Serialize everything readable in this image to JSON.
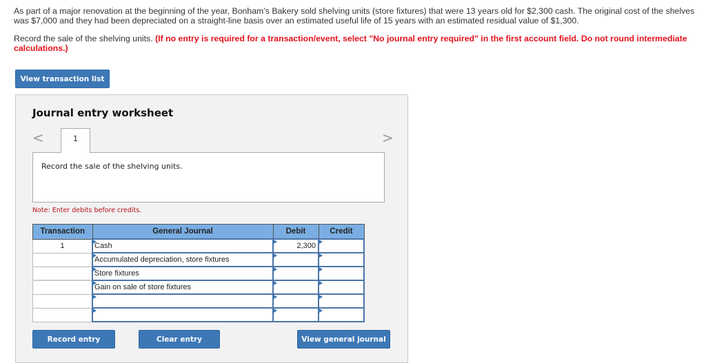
{
  "problem": {
    "paragraph1": "As part of a major renovation at the beginning of the year, Bonham’s Bakery sold shelving units (store fixtures) that were 13 years old for $2,300 cash. The original cost of the shelves was $7,000 and they had been depreciated on a straight-line basis over an estimated useful life of 15 years with an estimated residual value of $1,300.",
    "instruction": "Record the sale of the shelving units.",
    "instruction_note": "(If no entry is required for a transaction/event, select \"No journal entry required\" in the first account field. Do not round intermediate calculations.)"
  },
  "buttons": {
    "view_transaction_list": "View transaction list",
    "record_entry": "Record entry",
    "clear_entry": "Clear entry",
    "view_general_journal": "View general journal"
  },
  "worksheet": {
    "title": "Journal entry worksheet",
    "prev_icon": "<",
    "next_icon": ">",
    "active_tab": "1",
    "description": "Record the sale of the shelving units.",
    "note": "Note: Enter debits before credits."
  },
  "journal": {
    "headers": [
      "Transaction",
      "General Journal",
      "Debit",
      "Credit"
    ],
    "rows": [
      {
        "transaction": "1",
        "account": "Cash",
        "debit": "2,300",
        "credit": ""
      },
      {
        "transaction": "",
        "account": "Accumulated depreciation, store fixtures",
        "debit": "",
        "credit": ""
      },
      {
        "transaction": "",
        "account": "Store fixtures",
        "debit": "",
        "credit": ""
      },
      {
        "transaction": "",
        "account": "Gain on sale of store fixtures",
        "debit": "",
        "credit": ""
      },
      {
        "transaction": "",
        "account": "",
        "debit": "",
        "credit": ""
      },
      {
        "transaction": "",
        "account": "",
        "debit": "",
        "credit": ""
      }
    ]
  },
  "colors": {
    "button_blue": "#3d78b6",
    "header_blue": "#7aaee3",
    "warning_red": "#e3101b"
  }
}
